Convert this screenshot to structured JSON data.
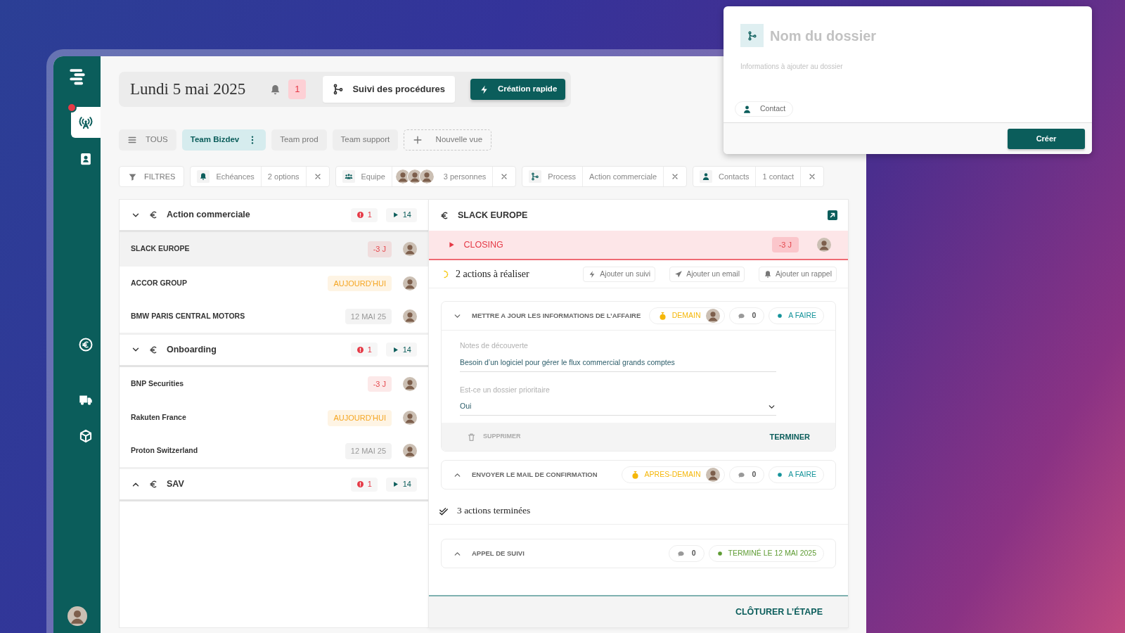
{
  "nav": [
    {
      "selected": true,
      "alert": true
    },
    {
      "selected": false,
      "alert": false
    },
    {
      "selected": false,
      "alert": false
    },
    {
      "selected": false,
      "alert": false
    },
    {
      "selected": false,
      "alert": false
    }
  ],
  "header": {
    "date": "Lundi 5 mai 2025",
    "notifications": "1",
    "buttons": [
      {
        "label": "Suivi des procédures",
        "kind": "secondary"
      },
      {
        "label": "Création rapide",
        "kind": "primary"
      }
    ]
  },
  "views": [
    {
      "label": "TOUS",
      "selected": false
    },
    {
      "label": "Team Bizdev",
      "selected": true
    },
    {
      "label": "Team prod",
      "selected": false
    },
    {
      "label": "Team support",
      "selected": false
    }
  ],
  "new_view": "Nouvelle vue",
  "filters": {
    "label": "FILTRES",
    "items": [
      {
        "kind": "deadline",
        "name": "Echéances",
        "value": "2 options"
      },
      {
        "kind": "people",
        "name": "Equipe",
        "value": "3 personnes"
      },
      {
        "kind": "process",
        "name": "Process",
        "value": "Action commerciale"
      },
      {
        "kind": "contact",
        "name": "Contacts",
        "value": "1 contact"
      }
    ]
  },
  "groups": [
    {
      "title": "Action commerciale",
      "alerts": "1",
      "count": "14",
      "expanded": true,
      "rows": [
        {
          "name": "SLACK EUROPE",
          "due": "-3 J",
          "color": "#e5484d",
          "selected": true
        },
        {
          "name": "ACCOR GROUP",
          "due": "AUJOURD’HUI",
          "color": "#f5a623",
          "selected": false
        },
        {
          "name": "BMW PARIS CENTRAL MOTORS",
          "due": "12 MAI 25",
          "color": "#999999",
          "selected": false
        }
      ]
    },
    {
      "title": "Onboarding",
      "alerts": "1",
      "count": "14",
      "expanded": true,
      "rows": [
        {
          "name": "BNP Securities",
          "due": "-3 J",
          "color": "#e5484d",
          "selected": false
        },
        {
          "name": "Rakuten France",
          "due": "AUJOURD’HUI",
          "color": "#f5a623",
          "selected": false
        },
        {
          "name": "Proton Switzerland",
          "due": "12 MAI 25",
          "color": "#999999",
          "selected": false
        }
      ]
    },
    {
      "title": "SAV",
      "alerts": "1",
      "count": "14",
      "expanded": false
    }
  ],
  "detail": {
    "title": "SLACK EUROPE",
    "stage": {
      "name": "CLOSING",
      "due": "-3 J"
    },
    "todo_title": "2 actions à réaliser",
    "add_buttons": [
      {
        "kind": "followup",
        "label": "Ajouter un suivi"
      },
      {
        "kind": "email",
        "label": "Ajouter un email"
      },
      {
        "kind": "reminder",
        "label": "Ajouter un rappel"
      }
    ],
    "todo": [
      {
        "title": "METTRE A JOUR LES INFORMATIONS DE L’AFFAIRE",
        "expanded": true,
        "due": "DEMAIN",
        "comments": "0",
        "status": "A FAIRE",
        "color": "#14939a",
        "fields": [
          {
            "kind": "text",
            "label": "Notes de découverte",
            "value": "Besoin d’un logiciel pour gérer le flux commercial grands comptes"
          },
          {
            "kind": "select",
            "label": "Est-ce un dossier prioritaire",
            "value": "Oui"
          }
        ],
        "delete": "SUPPRIMER",
        "finish": "TERMINER"
      },
      {
        "title": "ENVOYER LE MAIL DE CONFIRMATION",
        "expanded": false,
        "due": "APRES-DEMAIN",
        "comments": "0",
        "status": "A FAIRE",
        "color": "#14939a"
      }
    ],
    "done_title": "3 actions terminées",
    "done": [
      {
        "title": "APPEL DE SUIVI",
        "expanded": false,
        "comments": "0",
        "status": "TERMINÉ LE 12 MAI 2025",
        "color": "#5d9b32"
      }
    ],
    "close_button": "CLÔTURER L’ÉTAPE"
  },
  "modal": {
    "title_placeholder": "Nom du dossier",
    "description_placeholder": "Informations à ajouter au dossier",
    "chips": [
      "Contact"
    ],
    "submit": "Créer"
  }
}
